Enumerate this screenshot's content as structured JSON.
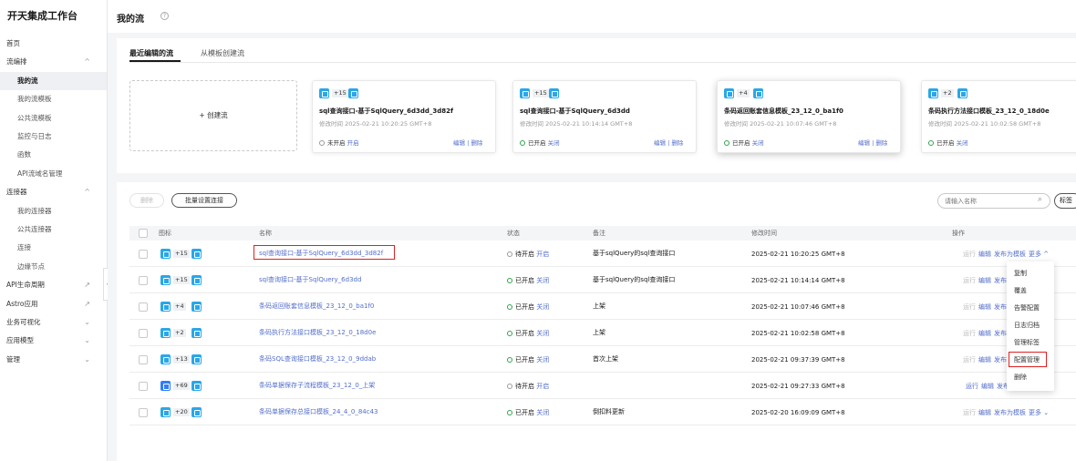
{
  "sidebar": {
    "title": "开天集成工作台",
    "items": [
      {
        "label": "首页",
        "chev": ""
      },
      {
        "label": "流编排",
        "chev": "^"
      },
      {
        "label": "我的流",
        "chev": ""
      },
      {
        "label": "我的流模板",
        "chev": ""
      },
      {
        "label": "公共流模板",
        "chev": ""
      },
      {
        "label": "监控与日志",
        "chev": ""
      },
      {
        "label": "函数",
        "chev": ""
      },
      {
        "label": "API流域名管理",
        "chev": ""
      },
      {
        "label": "连接器",
        "chev": "^"
      },
      {
        "label": "我的连接器",
        "chev": ""
      },
      {
        "label": "公共连接器",
        "chev": ""
      },
      {
        "label": "连接",
        "chev": ""
      },
      {
        "label": "边缘节点",
        "chev": ""
      },
      {
        "label": "API生命周期",
        "chev": "↗"
      },
      {
        "label": "Astro应用",
        "chev": "↗"
      },
      {
        "label": "业务可视化",
        "chev": "⌄"
      },
      {
        "label": "应用模型",
        "chev": "⌄"
      },
      {
        "label": "管理",
        "chev": "⌄"
      }
    ]
  },
  "page": {
    "title": "我的流"
  },
  "tabs": [
    "最近编辑的流",
    "从模板创建流"
  ],
  "create_label": "+  创建流",
  "recent_cards": [
    {
      "count": "+15",
      "title": "sql查询接口-基于SqlQuery_6d3dd_3d82f",
      "time": "修改时间   2025-02-21 10:20:25 GMT+8",
      "state": "未开启",
      "toggle": "开启",
      "ops": "编辑  |  删除"
    },
    {
      "count": "+15",
      "title": "sql查询接口-基于SqlQuery_6d3dd",
      "time": "修改时间   2025-02-21 10:14:14 GMT+8",
      "state": "已开启",
      "toggle": "关闭",
      "ops": "编辑  |  删除"
    },
    {
      "count": "+4",
      "title": "条码返回账套信息模板_23_12_0_ba1f0",
      "time": "修改时间   2025-02-21 10:07:46 GMT+8",
      "state": "已开启",
      "toggle": "关闭",
      "ops": "编辑  |  删除"
    },
    {
      "count": "+2",
      "title": "条码执行方法接口模板_23_12_0_18d0e",
      "time": "修改时间   2025-02-21 10:02:58 GMT+8",
      "state": "已开启",
      "toggle": "关闭",
      "ops": ""
    }
  ],
  "toolbar": {
    "delete": "删除",
    "batch": "批量设置连接",
    "search_placeholder": "请输入名称",
    "tag": "标签"
  },
  "table": {
    "headers": [
      "图标",
      "名称",
      "状态",
      "备注",
      "修改时间",
      "操作"
    ],
    "rows": [
      {
        "count": "+15",
        "name": "sql查询接口-基于SqlQuery_6d3dd_3d82f",
        "state": "待开启",
        "toggle": "开启",
        "remark": "基于sqlQuery的sql查询接口",
        "time": "2025-02-21 10:20:25 GMT+8",
        "ops": [
          "运行",
          "编辑",
          "发布为模板",
          "更多 ^"
        ]
      },
      {
        "count": "+15",
        "name": "sql查询接口-基于SqlQuery_6d3dd",
        "state": "已开启",
        "toggle": "关闭",
        "remark": "基于sqlQuery的sql查询接口",
        "time": "2025-02-21 10:14:14 GMT+8",
        "ops": [
          "运行",
          "编辑",
          "发布"
        ]
      },
      {
        "count": "+4",
        "name": "条码返回账套信息模板_23_12_0_ba1f0",
        "state": "已开启",
        "toggle": "关闭",
        "remark": "上架",
        "time": "2025-02-21 10:07:46 GMT+8",
        "ops": [
          "运行",
          "编辑",
          "发布"
        ]
      },
      {
        "count": "+2",
        "name": "条码执行方法接口模板_23_12_0_18d0e",
        "state": "已开启",
        "toggle": "关闭",
        "remark": "上架",
        "time": "2025-02-21 10:02:58 GMT+8",
        "ops": [
          "运行",
          "编辑",
          "发布"
        ]
      },
      {
        "count": "+13",
        "name": "条码SQL查询接口模板_23_12_0_9ddab",
        "state": "已开启",
        "toggle": "关闭",
        "remark": "首次上架",
        "time": "2025-02-21 09:37:39 GMT+8",
        "ops": [
          "运行",
          "编辑",
          "发布"
        ]
      },
      {
        "count": "+69",
        "name": "条码单据保存子流程模板_23_12_0_上架",
        "state": "待开启",
        "toggle": "开启",
        "remark": "",
        "time": "2025-02-21 09:27:33 GMT+8",
        "ops": [
          "运行",
          "编辑",
          "发布为模板",
          "更多 ⌄"
        ]
      },
      {
        "count": "+20",
        "name": "条码单据保存总接口模板_24_4_0_84c43",
        "state": "已开启",
        "toggle": "关闭",
        "remark": "倒扣料更新",
        "time": "2025-02-20 16:09:09 GMT+8",
        "ops": [
          "运行",
          "编辑",
          "发布为模板",
          "更多 ⌄"
        ]
      }
    ]
  },
  "more_menu": [
    "复制",
    "覆盖",
    "告警配置",
    "日志归档",
    "管理标签",
    "配置管理",
    "删除"
  ]
}
